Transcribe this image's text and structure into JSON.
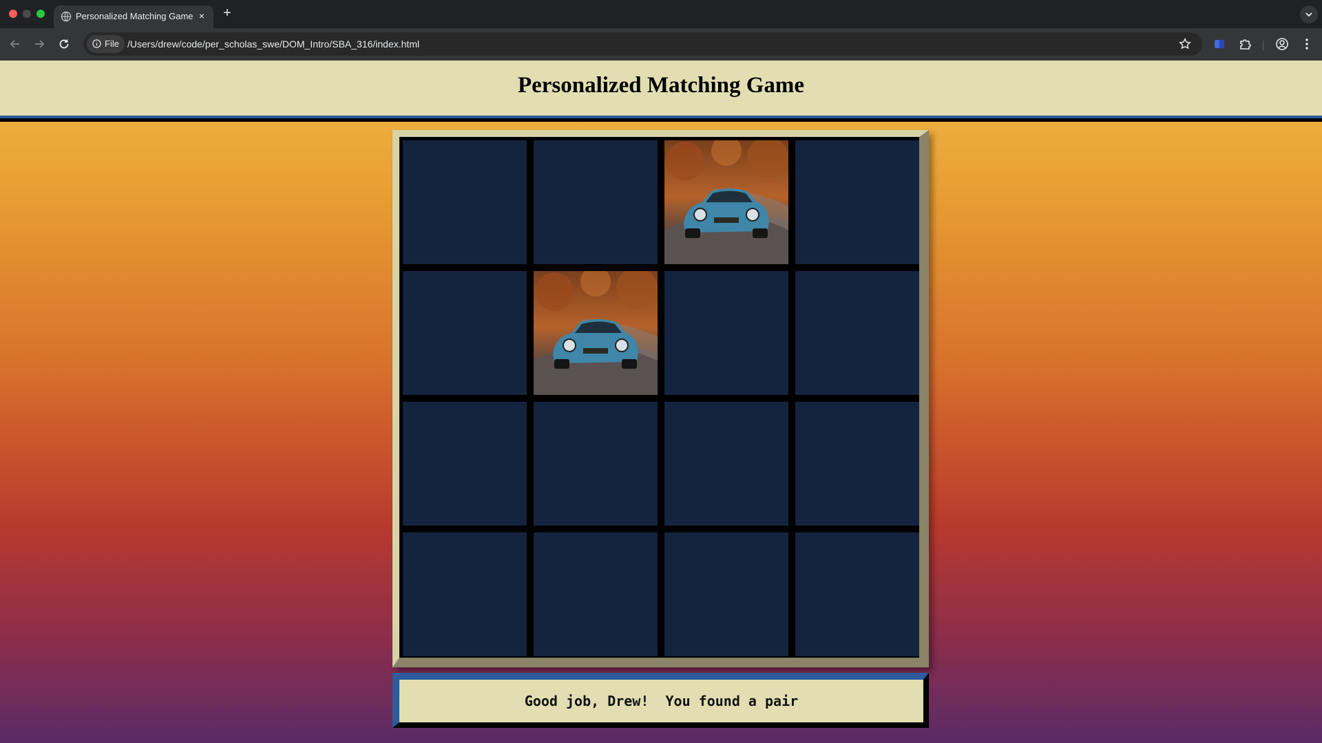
{
  "browser": {
    "tab_title": "Personalized Matching Game",
    "new_tab_label": "+",
    "close_label": "×",
    "site_chip": "File",
    "url": "/Users/drew/code/per_scholas_swe/DOM_Intro/SBA_316/index.html"
  },
  "page": {
    "title": "Personalized Matching Game",
    "message": "Good job, Drew!  You found a pair"
  },
  "board": {
    "rows": 4,
    "cols": 4,
    "cards": [
      {
        "state": "face-down"
      },
      {
        "state": "face-down"
      },
      {
        "state": "face-up",
        "image": "blue-vintage-car"
      },
      {
        "state": "face-down"
      },
      {
        "state": "face-down"
      },
      {
        "state": "face-up",
        "image": "blue-vintage-car"
      },
      {
        "state": "face-down"
      },
      {
        "state": "face-down"
      },
      {
        "state": "face-down"
      },
      {
        "state": "face-down"
      },
      {
        "state": "face-down"
      },
      {
        "state": "face-down"
      },
      {
        "state": "face-down"
      },
      {
        "state": "face-down"
      },
      {
        "state": "face-down"
      },
      {
        "state": "face-down"
      }
    ]
  },
  "colors": {
    "card_back": "#14243f",
    "header_bg": "#e2deb2",
    "accent_blue": "#2d5b9b"
  }
}
